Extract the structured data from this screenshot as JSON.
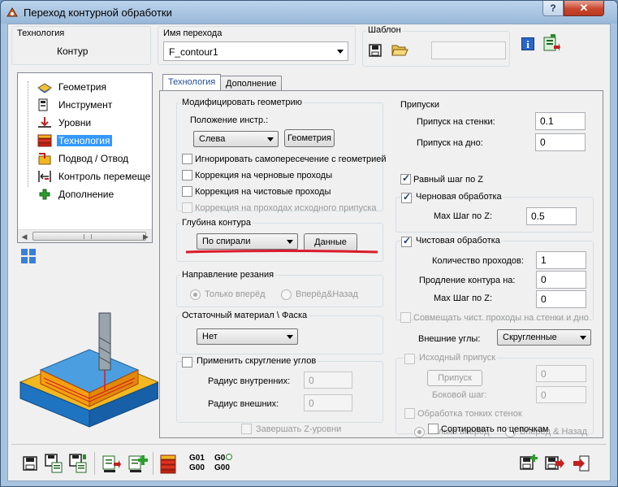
{
  "window": {
    "title": "Переход контурной обработки",
    "help": "?",
    "close": "✕"
  },
  "technology_box": {
    "label": "Технология",
    "value": "Контур"
  },
  "operation_name": {
    "label": "Имя перехода",
    "value": "F_contour1"
  },
  "template": {
    "label": "Шаблон",
    "value": ""
  },
  "tree": {
    "items": [
      {
        "label": "Геометрия",
        "icon": "geometry-icon",
        "selected": false
      },
      {
        "label": "Инструмент",
        "icon": "tool-icon",
        "selected": false
      },
      {
        "label": "Уровни",
        "icon": "levels-icon",
        "selected": false
      },
      {
        "label": "Технология",
        "icon": "technology-icon",
        "selected": true
      },
      {
        "label": "Подвод / Отвод",
        "icon": "approach-retract-icon",
        "selected": false
      },
      {
        "label": "Контроль перемеще",
        "icon": "motion-control-icon",
        "selected": false
      },
      {
        "label": "Дополнение",
        "icon": "addition-icon",
        "selected": false
      }
    ]
  },
  "tabs": [
    {
      "label": "Технология",
      "active": true
    },
    {
      "label": "Дополнение",
      "active": false
    }
  ],
  "modify_geometry": {
    "title": "Модифицировать геометрию",
    "tool_position_label": "Положение инстр.:",
    "tool_position_value": "Слева",
    "geometry_button": "Геометрия",
    "options": [
      {
        "label": "Игнорировать самопересечение с геометрией",
        "checked": false,
        "enabled": true
      },
      {
        "label": "Коррекция на черновые проходы",
        "checked": false,
        "enabled": true
      },
      {
        "label": "Коррекция на чистовые проходы",
        "checked": false,
        "enabled": true
      },
      {
        "label": "Коррекция на проходах исходного припуска",
        "checked": false,
        "enabled": false
      }
    ]
  },
  "contour_depth": {
    "title": "Глубина контура",
    "mode": "По спирали",
    "data_button": "Данные"
  },
  "cut_direction": {
    "title": "Направление резания",
    "options": [
      "Только вперёд",
      "Вперёд&Назад"
    ]
  },
  "residual_material": {
    "title": "Остаточный материал \\ Фаска",
    "value": "Нет"
  },
  "corner_rounding": {
    "title": "Применить скругление углов",
    "inner_radius_label": "Радиус внутренних:",
    "inner_radius": "0",
    "outer_radius_label": "Радиус внешних:",
    "outer_radius": "0"
  },
  "finish_z_levels": "Завершать Z-уровни",
  "allowances": {
    "title": "Припуски",
    "wall_label": "Припуск на стенки:",
    "wall": "0.1",
    "floor_label": "Припуск на дно:",
    "floor": "0"
  },
  "equal_z_step": "Равный шаг по Z",
  "rough_cutting": {
    "title": "Черновая обработка",
    "max_step_label": "Max Шаг по Z:",
    "max_step": "0.5"
  },
  "finish_cutting": {
    "title": "Чистовая обработка",
    "passes_label": "Количество проходов:",
    "passes": "1",
    "extension_label": "Продление контура на:",
    "extension": "0",
    "max_step_label": "Max Шаг по Z:",
    "max_step": "0"
  },
  "combine_finish": "Совмещать чист. проходы на стенки и дно",
  "outer_corners": {
    "label": "Внешние углы:",
    "value": "Скругленные"
  },
  "stock_allowance": {
    "title": "Исходный припуск",
    "allowance_button": "Припуск",
    "allowance": "0",
    "side_step_label": "Боковой шаг:",
    "side_step": "0",
    "thin_walls": "Обработка тонких стенок",
    "directions": [
      "Только вперёд",
      "Вперёд & Назад"
    ]
  },
  "sort_by_chains": "Сортировать по цепочкам",
  "gcode": {
    "g01": "G01",
    "g00": "G00",
    "g0": "G0"
  },
  "colors": {
    "accent_red": "#d81b2a",
    "tab_text": "#1f4e9a",
    "selection": "#3399ff"
  }
}
